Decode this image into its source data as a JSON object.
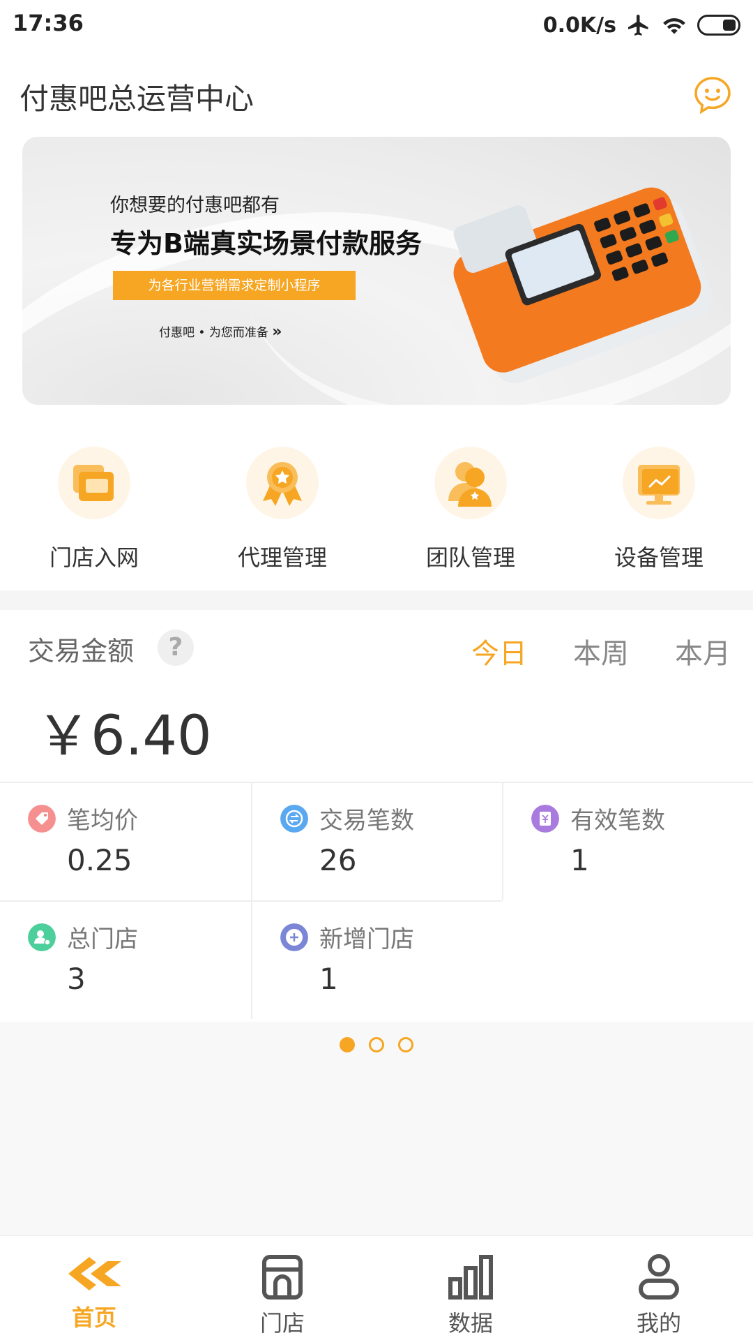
{
  "status_bar": {
    "time": "17:36",
    "net_speed": "0.0K/s"
  },
  "header": {
    "title": "付惠吧总运营中心",
    "chat_icon": "chat-bubble-icon"
  },
  "banner": {
    "line1": "你想要的付惠吧都有",
    "line2": "专为B端真实场景付款服务",
    "tag": "为各行业营销需求定制小程序",
    "foot": "付惠吧 • 为您而准备"
  },
  "quick_menu": [
    {
      "label": "门店入网",
      "icon": "store-icon"
    },
    {
      "label": "代理管理",
      "icon": "medal-icon"
    },
    {
      "label": "团队管理",
      "icon": "team-icon"
    },
    {
      "label": "设备管理",
      "icon": "monitor-icon"
    }
  ],
  "transaction": {
    "title": "交易金额",
    "help": "?",
    "tabs": [
      "今日",
      "本周",
      "本月"
    ],
    "active_tab": "今日",
    "amount": "￥6.40"
  },
  "stats": [
    {
      "label": "笔均价",
      "value": "0.25",
      "color": "#f47c7c",
      "icon": "tag-icon"
    },
    {
      "label": "交易笔数",
      "value": "26",
      "color": "#5aa8f0",
      "icon": "exchange-icon"
    },
    {
      "label": "有效笔数",
      "value": "1",
      "color": "#a97bdf",
      "icon": "receipt-icon"
    },
    {
      "label": "总门店",
      "value": "3",
      "color": "#4ccf9a",
      "icon": "user-icon"
    },
    {
      "label": "新增门店",
      "value": "1",
      "color": "#7b86d6",
      "icon": "plus-icon"
    }
  ],
  "pager": {
    "count": 3,
    "active": 0
  },
  "tabbar": [
    {
      "label": "首页",
      "icon": "home-logo-icon"
    },
    {
      "label": "门店",
      "icon": "store-icon"
    },
    {
      "label": "数据",
      "icon": "bar-chart-icon"
    },
    {
      "label": "我的",
      "icon": "user-icon"
    }
  ],
  "colors": {
    "accent": "#f6a623"
  }
}
